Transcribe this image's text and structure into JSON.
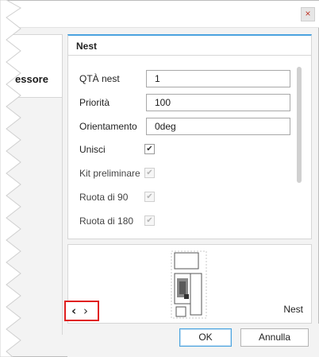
{
  "dialog": {
    "close_label": "×"
  },
  "left_tab": {
    "label": "essore"
  },
  "tab": {
    "label": "Nest"
  },
  "properties": [
    {
      "label": "QTÀ nest",
      "type": "input",
      "value": "1"
    },
    {
      "label": "Priorità",
      "type": "input",
      "value": "100"
    },
    {
      "label": "Orientamento",
      "type": "input",
      "value": "0deg"
    },
    {
      "label": "Unisci",
      "type": "checkbox",
      "checked": true,
      "disabled": false
    },
    {
      "label": "Kit preliminare",
      "type": "checkbox",
      "checked": true,
      "disabled": true
    },
    {
      "label": "Ruota di 90",
      "type": "checkbox",
      "checked": true,
      "disabled": true
    },
    {
      "label": "Ruota di 180",
      "type": "checkbox",
      "checked": true,
      "disabled": true
    }
  ],
  "preview": {
    "label": "Nest",
    "prev_icon": "chevron-left-icon",
    "next_icon": "chevron-right-icon"
  },
  "footer": {
    "ok_label": "OK",
    "cancel_label": "Annulla"
  },
  "colors": {
    "accent": "#4aa3df",
    "highlight": "#e02020"
  }
}
